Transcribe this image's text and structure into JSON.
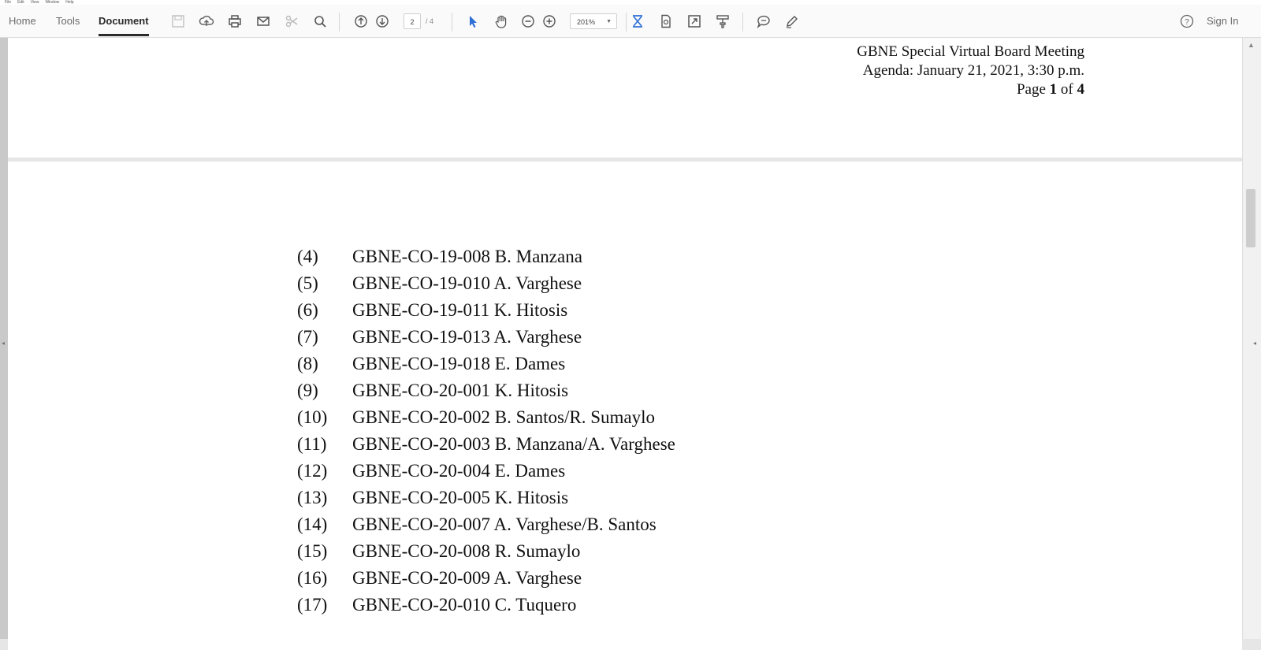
{
  "menubar": {
    "items": [
      "File",
      "Edit",
      "View",
      "Window",
      "Help"
    ]
  },
  "toolbar": {
    "tabs": [
      {
        "label": "Home"
      },
      {
        "label": "Tools"
      },
      {
        "label": "Document"
      }
    ],
    "page_current": "2",
    "page_total": "/ 4",
    "zoom": "201%",
    "sign_in": "Sign In"
  },
  "page1": {
    "header_line1": "GBNE Special Virtual Board Meeting",
    "header_line2": "Agenda: January 21, 2021, 3:30 p.m.",
    "page_word": "Page",
    "page_num": "1",
    "of_word": "of",
    "page_total": "4"
  },
  "page2": {
    "items": [
      {
        "num": "(4)",
        "text": "GBNE-CO-19-008 B. Manzana"
      },
      {
        "num": "(5)",
        "text": "GBNE-CO-19-010 A. Varghese"
      },
      {
        "num": "(6)",
        "text": "GBNE-CO-19-011 K. Hitosis"
      },
      {
        "num": "(7)",
        "text": "GBNE-CO-19-013 A. Varghese"
      },
      {
        "num": "(8)",
        "text": "GBNE-CO-19-018 E. Dames"
      },
      {
        "num": "(9)",
        "text": "GBNE-CO-20-001 K. Hitosis"
      },
      {
        "num": "(10)",
        "text": "GBNE-CO-20-002 B. Santos/R. Sumaylo"
      },
      {
        "num": "(11)",
        "text": "GBNE-CO-20-003 B. Manzana/A. Varghese"
      },
      {
        "num": "(12)",
        "text": "GBNE-CO-20-004 E. Dames"
      },
      {
        "num": "(13)",
        "text": "GBNE-CO-20-005 K. Hitosis"
      },
      {
        "num": "(14)",
        "text": "GBNE-CO-20-007 A. Varghese/B. Santos"
      },
      {
        "num": "(15)",
        "text": "GBNE-CO-20-008 R. Sumaylo"
      },
      {
        "num": "(16)",
        "text": "GBNE-CO-20-009 A. Varghese"
      },
      {
        "num": "(17)",
        "text": "GBNE-CO-20-010 C. Tuquero"
      }
    ]
  },
  "icons": {
    "save": "save-icon",
    "upload": "cloud-upload-icon",
    "print": "print-icon",
    "email": "mail-icon",
    "cut": "scissors-icon",
    "search": "search-icon",
    "prev": "page-up-icon",
    "next": "page-down-icon",
    "select": "select-cursor-icon",
    "hand": "hand-icon",
    "zoom_out": "zoom-out-icon",
    "zoom_in": "zoom-in-icon",
    "fit": "fit-page-icon",
    "scroll": "scroll-mode-icon",
    "fullscreen": "full-screen-icon",
    "highlight": "highlight-icon",
    "comment": "comment-icon",
    "sign": "pen-icon",
    "help": "help-icon"
  },
  "colors": {
    "accent_blue": "#2d6fd6",
    "toolbar_bg": "#fafafa",
    "canvas_bg": "#e6e6e6"
  }
}
